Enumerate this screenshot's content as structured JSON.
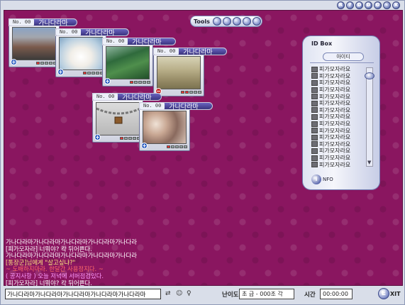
{
  "window": {
    "buttons": [
      "R",
      "?",
      "D",
      "D",
      "O",
      "-",
      "X"
    ]
  },
  "tools": {
    "label": "Tools"
  },
  "rooms": [
    {
      "no": "No. 00",
      "name": "가나다라마",
      "marker": "+",
      "scene": "street"
    },
    {
      "no": "No. 00",
      "name": "가나다라마",
      "marker": "+",
      "scene": "polar-bear"
    },
    {
      "no": "No. 00",
      "name": "가나다라마",
      "marker": "+",
      "scene": "jungle"
    },
    {
      "no": "No. 00",
      "name": "가나다라마",
      "marker": "−",
      "scene": "statues"
    },
    {
      "no": "No. 00",
      "name": "가나다라마",
      "marker": "+",
      "scene": "locked"
    },
    {
      "no": "No. 00",
      "name": "가나다라마",
      "marker": "+",
      "scene": "shells"
    }
  ],
  "idbox": {
    "title": "ID Box",
    "header": "아이디",
    "entries": [
      "피가모자라요",
      "피가모자라요",
      "피가모자라요",
      "피가모자라요",
      "피가모자라요",
      "피가모자라요",
      "피가모자라요",
      "피가모자라요",
      "피가모자라요",
      "피가모자라요",
      "피가모자라요",
      "피가모자라요",
      "피가모자라요",
      "피가모자라요",
      "피가모자라요"
    ],
    "info_label": "NFO"
  },
  "chat": {
    "lines": [
      {
        "text": "가나다라마가나다라마가나다라마가나다라마가나다라",
        "color": "#ffffff"
      },
      {
        "text": "[피가모자라] 너뭐야? 칵 뒤어쁜다.",
        "color": "#ffffff"
      },
      {
        "text": "가나다라마가나다라마가나다라마가나다라마가나다라",
        "color": "#ffffff"
      },
      {
        "text": "[통장군]님에게 \"살고싶냐?\"",
        "color": "#ffe680"
      },
      {
        "text": "~ 도배하지마라. 한달간 사용정지다. ~",
        "color": "#ff6a6a"
      },
      {
        "text": "( 공지사항 ) 오늘 저녁에 서버점검있다.",
        "color": "#ff9aff"
      },
      {
        "text": "[피가모자라] 너뭐야? 칵 뒤어쁜다.",
        "color": "#ffffff"
      }
    ]
  },
  "bottom": {
    "input_value": "가나다라마가나다라마가나다라마가나다라마가나다라마",
    "difficulty_label": "난이도",
    "difficulty_value": "초  급 - 000조 각",
    "time_label": "시간",
    "time_value": "00:00:00",
    "exit_label": "XIT"
  },
  "colors": {
    "board": "#8a1660",
    "tag": "#3a347f"
  }
}
